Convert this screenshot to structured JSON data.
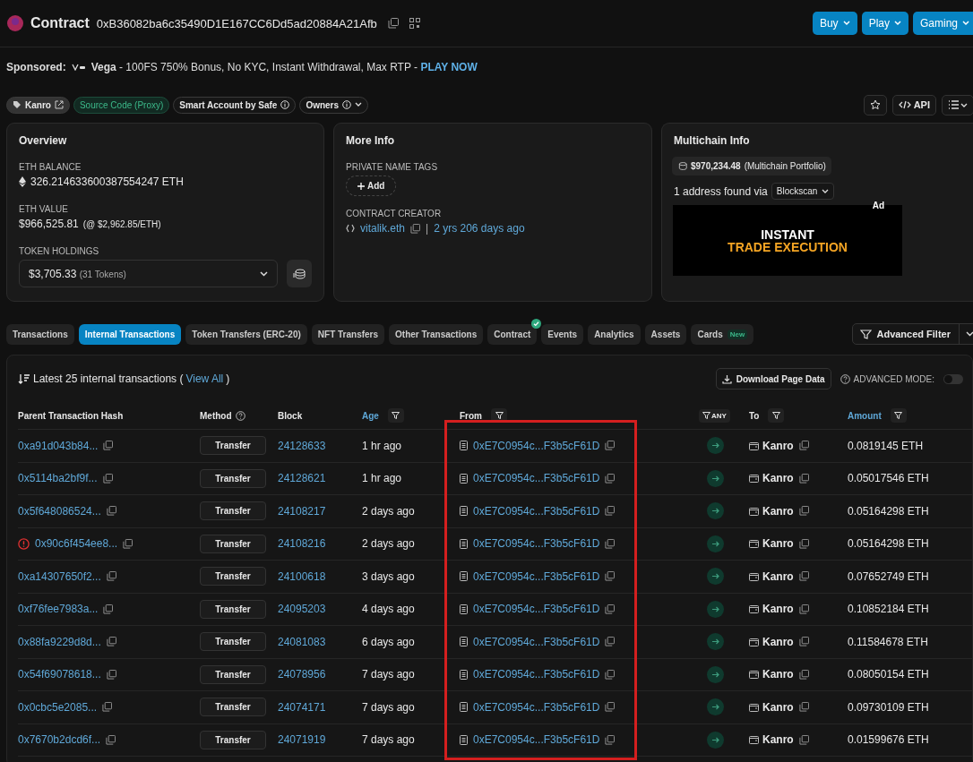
{
  "header": {
    "title": "Contract",
    "address": "0xB36082ba6c35490D1E167CC6Dd5ad20884A21Afb",
    "buttons": [
      "Buy",
      "Play",
      "Gaming"
    ]
  },
  "sponsored": {
    "label": "Sponsored:",
    "text": "**Vega** - 100FS 750% Bonus, No KYC, Instant Withdrawal, Max RTP - ",
    "link": "PLAY NOW"
  },
  "tags": [
    {
      "label": "Kanro",
      "kind": "name"
    },
    {
      "label": "Source Code (Proxy)",
      "kind": "source"
    },
    {
      "label": "Smart Account by Safe",
      "kind": "info"
    },
    {
      "label": "Owners",
      "kind": "menu"
    }
  ],
  "actions": {
    "api": "API"
  },
  "overview": {
    "title": "Overview",
    "balance_label": "ETH BALANCE",
    "balance": "326.214633600387554247 ETH",
    "value_label": "ETH VALUE",
    "value": "$966,525.81",
    "rate": "(@ $2,962.85/ETH)",
    "holdings_label": "TOKEN HOLDINGS",
    "holdings": "$3,705.33",
    "tokens": "(31 Tokens)"
  },
  "more_info": {
    "title": "More Info",
    "tags_label": "PRIVATE NAME TAGS",
    "add": "Add",
    "creator_label": "CONTRACT CREATOR",
    "creator": "vitalik.eth",
    "separator": "|",
    "age": "2 yrs 206 days ago"
  },
  "multichain": {
    "title": "Multichain Info",
    "portfolio": "$970,234.48",
    "portfolio_note": "(Multichain Portfolio)",
    "found": "1 address found via",
    "via": "Blockscan",
    "ad_label": "Ad",
    "ad_line1": "INSTANT",
    "ad_line2": "TRADE EXECUTION"
  },
  "tabs": [
    {
      "label": "Transactions",
      "selected": false
    },
    {
      "label": "Internal Transactions",
      "selected": true
    },
    {
      "label": "Token Transfers (ERC-20)",
      "selected": false
    },
    {
      "label": "NFT Transfers",
      "selected": false
    },
    {
      "label": "Other Transactions",
      "selected": false
    },
    {
      "label": "Contract",
      "selected": false,
      "verified": true
    },
    {
      "label": "Events",
      "selected": false
    },
    {
      "label": "Analytics",
      "selected": false
    },
    {
      "label": "Assets",
      "selected": false
    },
    {
      "label": "Cards",
      "selected": false,
      "badge": "New"
    }
  ],
  "advanced_filter": "Advanced Filter",
  "table": {
    "summary": "Latest 25 internal transactions (",
    "view_all": "View All",
    "summary_end": ")",
    "download": "Download Page Data",
    "advanced_mode": {
      "label": "ADVANCED MODE:",
      "on": false
    },
    "columns": [
      {
        "label": "Parent Transaction Hash",
        "kind": "plain"
      },
      {
        "label": "Method",
        "kind": "help"
      },
      {
        "label": "Block",
        "kind": "plain"
      },
      {
        "label": "Age",
        "kind": "link-filter"
      },
      {
        "label": "From",
        "kind": "filter"
      },
      {
        "label": "ANY",
        "kind": "chip"
      },
      {
        "label": "To",
        "kind": "filter"
      },
      {
        "label": "Amount",
        "kind": "link-filter"
      }
    ],
    "rows": [
      {
        "hash": "0xa91d043b84...",
        "failed": false,
        "method": "Transfer",
        "block": "24128633",
        "age": "1 hr ago",
        "from": "0xE7C0954c...F3b5cF61D",
        "to": "Kanro",
        "amount": "0.0819145 ETH"
      },
      {
        "hash": "0x5114ba2bf9f...",
        "failed": false,
        "method": "Transfer",
        "block": "24128621",
        "age": "1 hr ago",
        "from": "0xE7C0954c...F3b5cF61D",
        "to": "Kanro",
        "amount": "0.05017546 ETH"
      },
      {
        "hash": "0x5f648086524...",
        "failed": false,
        "method": "Transfer",
        "block": "24108217",
        "age": "2 days ago",
        "from": "0xE7C0954c...F3b5cF61D",
        "to": "Kanro",
        "amount": "0.05164298 ETH"
      },
      {
        "hash": "0x90c6f454ee8...",
        "failed": true,
        "method": "Transfer",
        "block": "24108216",
        "age": "2 days ago",
        "from": "0xE7C0954c...F3b5cF61D",
        "to": "Kanro",
        "amount": "0.05164298 ETH"
      },
      {
        "hash": "0xa14307650f2...",
        "failed": false,
        "method": "Transfer",
        "block": "24100618",
        "age": "3 days ago",
        "from": "0xE7C0954c...F3b5cF61D",
        "to": "Kanro",
        "amount": "0.07652749 ETH"
      },
      {
        "hash": "0xf76fee7983a...",
        "failed": false,
        "method": "Transfer",
        "block": "24095203",
        "age": "4 days ago",
        "from": "0xE7C0954c...F3b5cF61D",
        "to": "Kanro",
        "amount": "0.10852184 ETH"
      },
      {
        "hash": "0x88fa9229d8d...",
        "failed": false,
        "method": "Transfer",
        "block": "24081083",
        "age": "6 days ago",
        "from": "0xE7C0954c...F3b5cF61D",
        "to": "Kanro",
        "amount": "0.11584678 ETH"
      },
      {
        "hash": "0x54f69078618...",
        "failed": false,
        "method": "Transfer",
        "block": "24078956",
        "age": "7 days ago",
        "from": "0xE7C0954c...F3b5cF61D",
        "to": "Kanro",
        "amount": "0.08050154 ETH"
      },
      {
        "hash": "0x0cbc5e2085...",
        "failed": false,
        "method": "Transfer",
        "block": "24074171",
        "age": "7 days ago",
        "from": "0xE7C0954c...F3b5cF61D",
        "to": "Kanro",
        "amount": "0.09730109 ETH"
      },
      {
        "hash": "0x7670b2dcd6f...",
        "failed": false,
        "method": "Transfer",
        "block": "24071919",
        "age": "7 days ago",
        "from": "0xE7C0954c...F3b5cF61D",
        "to": "Kanro",
        "amount": "0.01599676 ETH"
      }
    ]
  }
}
